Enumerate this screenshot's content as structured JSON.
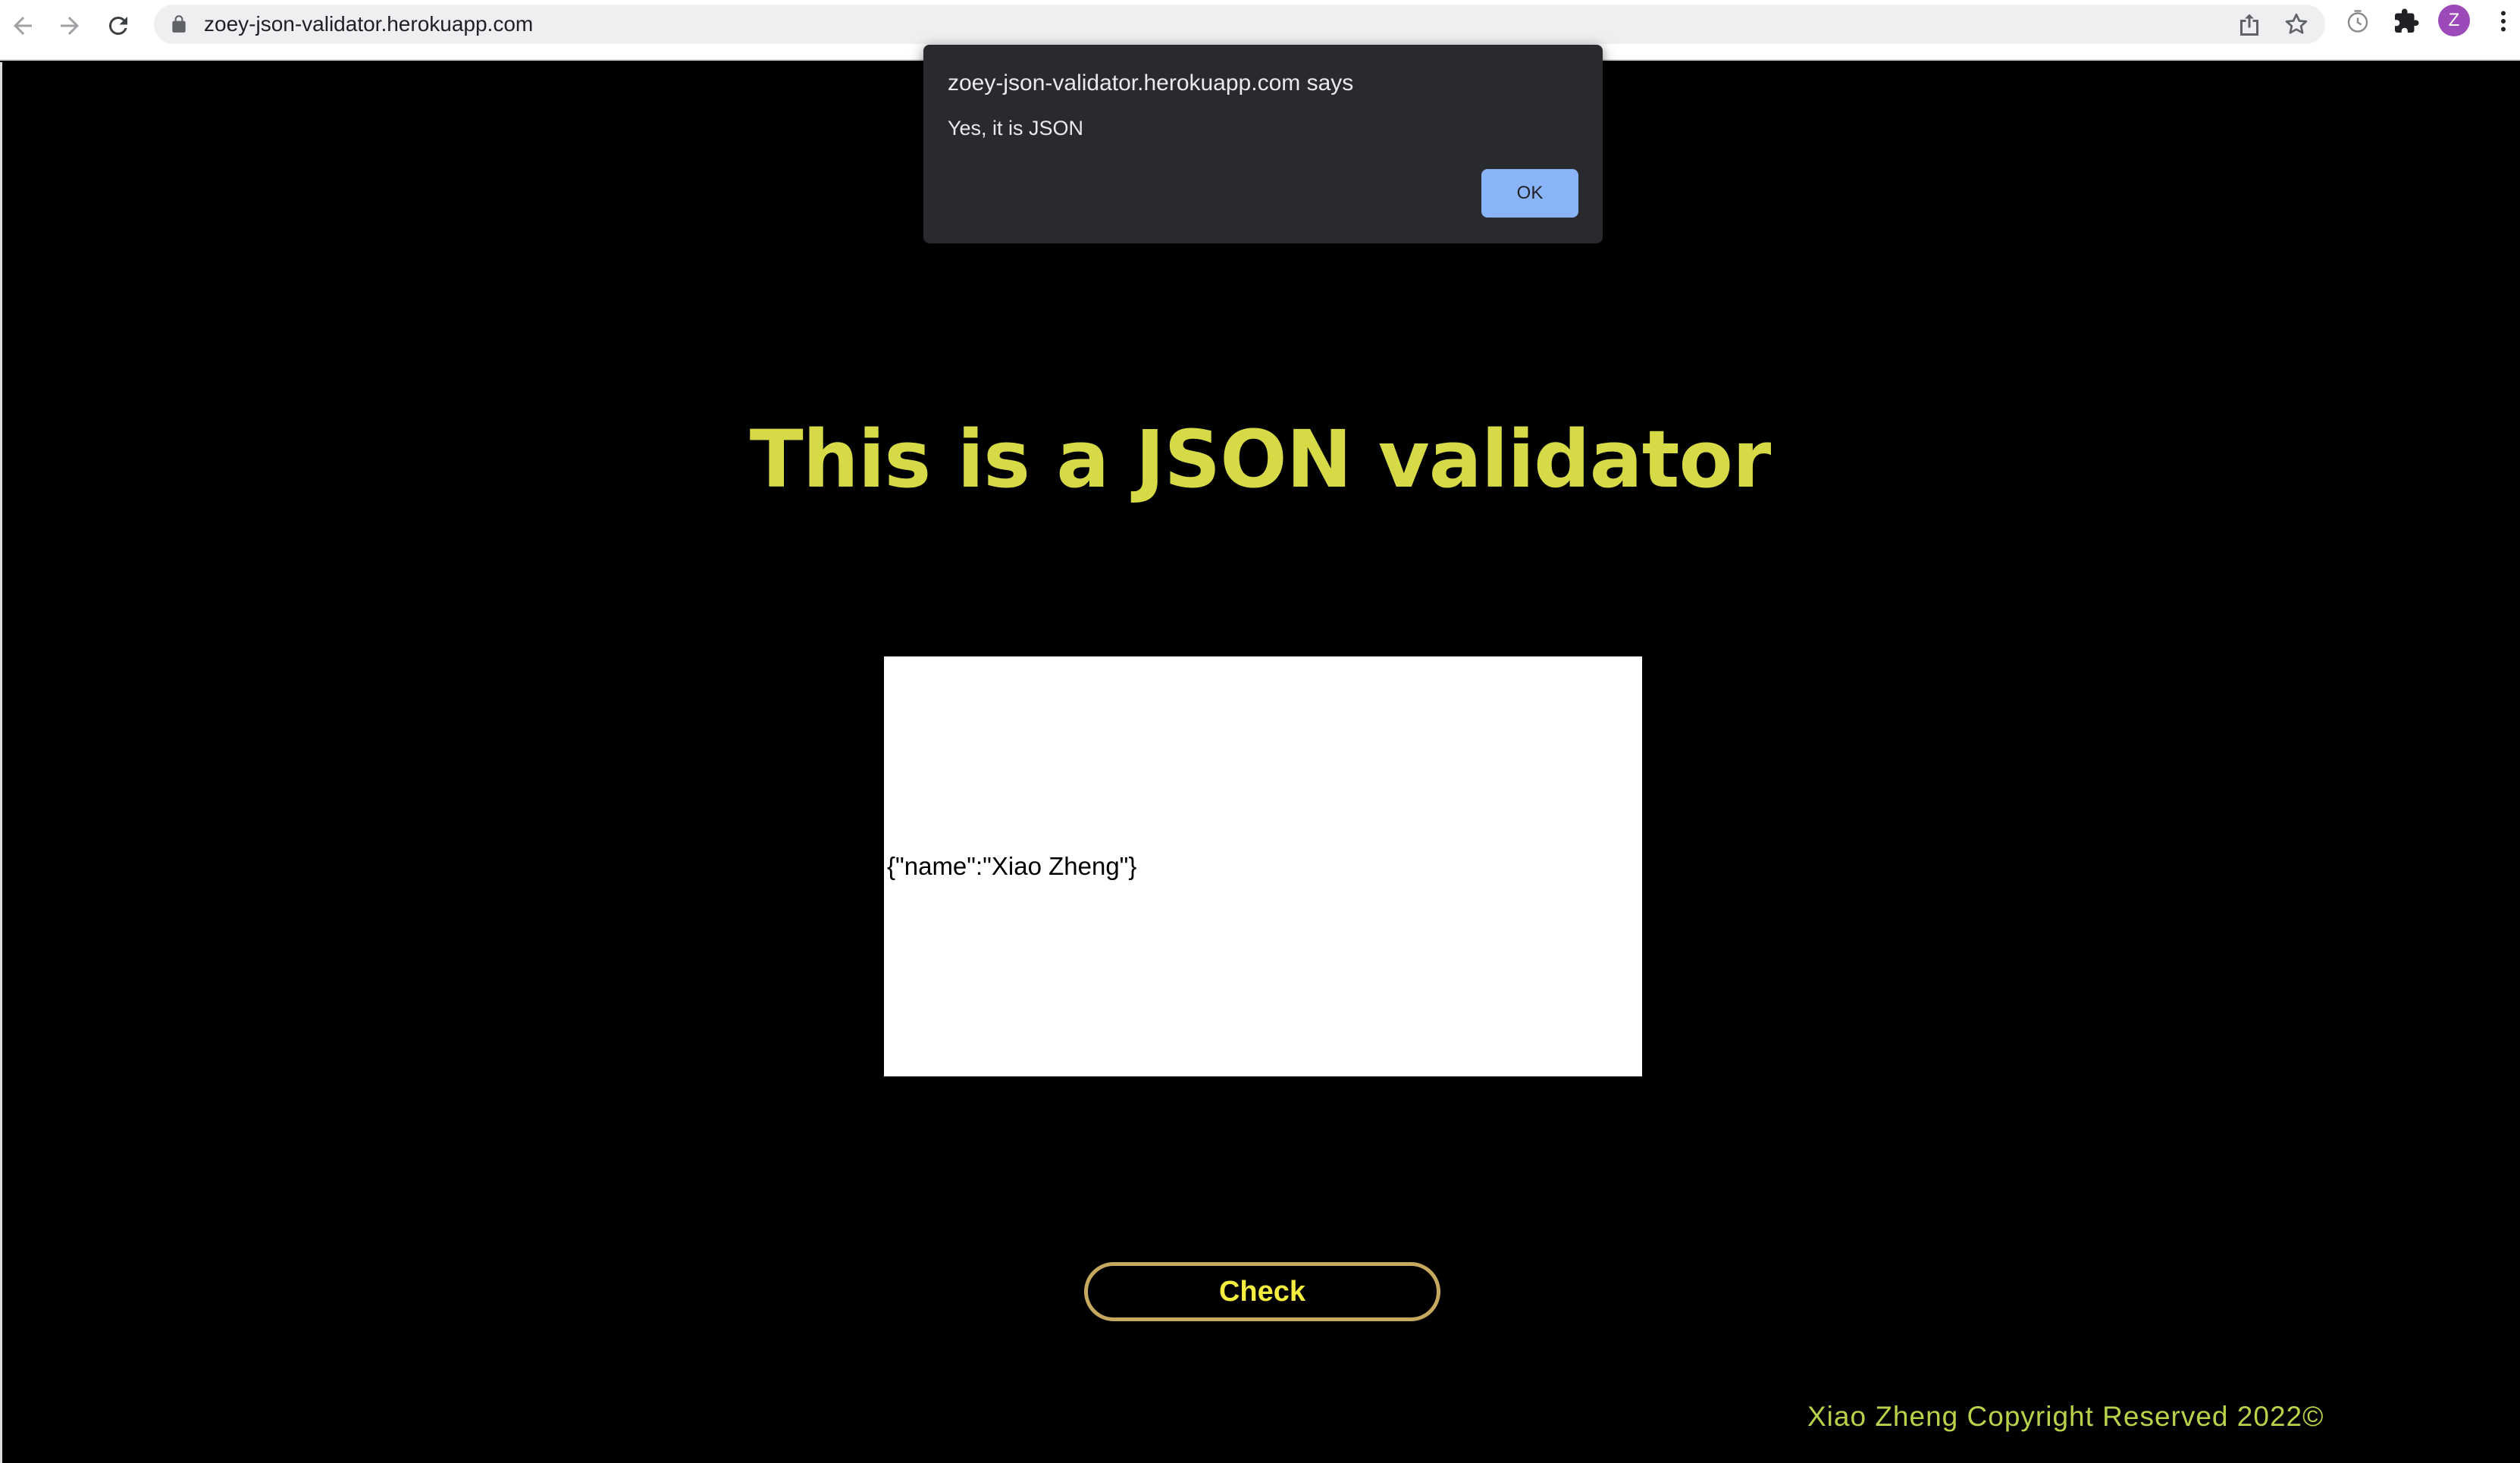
{
  "browser": {
    "url": "zoey-json-validator.herokuapp.com",
    "profile_initial": "Z",
    "icons": {
      "back": "back-arrow-icon",
      "forward": "forward-arrow-icon",
      "reload": "reload-icon",
      "lock": "lock-icon",
      "share": "share-icon",
      "bookmark": "star-icon",
      "extension_timer": "timer-extension-icon",
      "extensions": "puzzle-icon",
      "menu": "kebab-menu-icon"
    }
  },
  "dialog": {
    "title": "zoey-json-validator.herokuapp.com says",
    "message": "Yes, it is JSON",
    "ok_label": "OK"
  },
  "main": {
    "title": "This is a JSON validator",
    "input_value": "{\"name\":\"Xiao Zheng\"}",
    "check_label": "Check",
    "footer": "Xiao Zheng Copyright Reserved 2022©"
  },
  "colors": {
    "page_background": "#000000",
    "title": "#d6da46",
    "button_border": "#c6a85e",
    "button_text": "#f4ec3e",
    "footer_text": "#b8d24a",
    "dialog_background": "#292a2d",
    "dialog_button": "#8ab4f8"
  }
}
